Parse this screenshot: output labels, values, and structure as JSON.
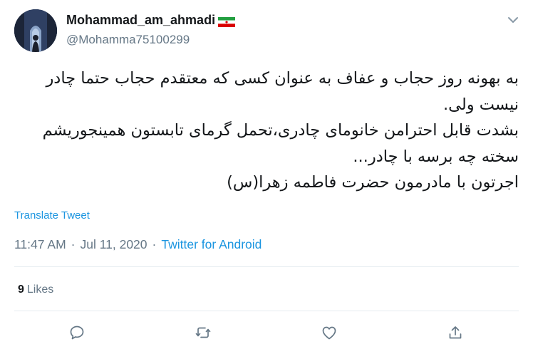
{
  "author": {
    "display_name": "Mohammad_am_ahmadi",
    "handle": "@Mohamma75100299",
    "flag_icon": "iran-flag-icon"
  },
  "tweet": {
    "text": "به بهونه روز حجاب و عفاف به عنوان کسی که معتقدم حجاب حتما چادر نیست ولی.\nبشدت قابل احترامن خانومای چادری،تحمل گرمای تابستون همینجوریشم سخته چه برسه با چادر...\nاجرتون با مادرمون حضرت فاطمه زهرا(س)"
  },
  "translate_label": "Translate Tweet",
  "meta": {
    "time": "11:47 AM",
    "separator": "·",
    "date": "Jul 11, 2020",
    "separator2": "·",
    "source": "Twitter for Android"
  },
  "stats": {
    "likes_count": "9",
    "likes_label": "Likes"
  },
  "actions": [
    "reply-icon",
    "retweet-icon",
    "like-icon",
    "share-icon"
  ],
  "colors": {
    "link": "#1b95e0",
    "secondary_text": "#657786",
    "divider": "#e6ecf0",
    "primary_text": "#14171a"
  }
}
